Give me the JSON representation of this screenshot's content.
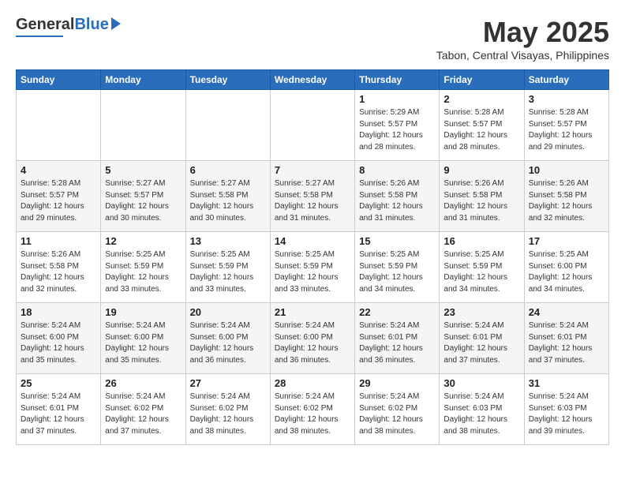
{
  "header": {
    "logo_general": "General",
    "logo_blue": "Blue",
    "month": "May 2025",
    "location": "Tabon, Central Visayas, Philippines"
  },
  "weekdays": [
    "Sunday",
    "Monday",
    "Tuesday",
    "Wednesday",
    "Thursday",
    "Friday",
    "Saturday"
  ],
  "weeks": [
    [
      {
        "day": "",
        "info": ""
      },
      {
        "day": "",
        "info": ""
      },
      {
        "day": "",
        "info": ""
      },
      {
        "day": "",
        "info": ""
      },
      {
        "day": "1",
        "info": "Sunrise: 5:29 AM\nSunset: 5:57 PM\nDaylight: 12 hours\nand 28 minutes."
      },
      {
        "day": "2",
        "info": "Sunrise: 5:28 AM\nSunset: 5:57 PM\nDaylight: 12 hours\nand 28 minutes."
      },
      {
        "day": "3",
        "info": "Sunrise: 5:28 AM\nSunset: 5:57 PM\nDaylight: 12 hours\nand 29 minutes."
      }
    ],
    [
      {
        "day": "4",
        "info": "Sunrise: 5:28 AM\nSunset: 5:57 PM\nDaylight: 12 hours\nand 29 minutes."
      },
      {
        "day": "5",
        "info": "Sunrise: 5:27 AM\nSunset: 5:57 PM\nDaylight: 12 hours\nand 30 minutes."
      },
      {
        "day": "6",
        "info": "Sunrise: 5:27 AM\nSunset: 5:58 PM\nDaylight: 12 hours\nand 30 minutes."
      },
      {
        "day": "7",
        "info": "Sunrise: 5:27 AM\nSunset: 5:58 PM\nDaylight: 12 hours\nand 31 minutes."
      },
      {
        "day": "8",
        "info": "Sunrise: 5:26 AM\nSunset: 5:58 PM\nDaylight: 12 hours\nand 31 minutes."
      },
      {
        "day": "9",
        "info": "Sunrise: 5:26 AM\nSunset: 5:58 PM\nDaylight: 12 hours\nand 31 minutes."
      },
      {
        "day": "10",
        "info": "Sunrise: 5:26 AM\nSunset: 5:58 PM\nDaylight: 12 hours\nand 32 minutes."
      }
    ],
    [
      {
        "day": "11",
        "info": "Sunrise: 5:26 AM\nSunset: 5:58 PM\nDaylight: 12 hours\nand 32 minutes."
      },
      {
        "day": "12",
        "info": "Sunrise: 5:25 AM\nSunset: 5:59 PM\nDaylight: 12 hours\nand 33 minutes."
      },
      {
        "day": "13",
        "info": "Sunrise: 5:25 AM\nSunset: 5:59 PM\nDaylight: 12 hours\nand 33 minutes."
      },
      {
        "day": "14",
        "info": "Sunrise: 5:25 AM\nSunset: 5:59 PM\nDaylight: 12 hours\nand 33 minutes."
      },
      {
        "day": "15",
        "info": "Sunrise: 5:25 AM\nSunset: 5:59 PM\nDaylight: 12 hours\nand 34 minutes."
      },
      {
        "day": "16",
        "info": "Sunrise: 5:25 AM\nSunset: 5:59 PM\nDaylight: 12 hours\nand 34 minutes."
      },
      {
        "day": "17",
        "info": "Sunrise: 5:25 AM\nSunset: 6:00 PM\nDaylight: 12 hours\nand 34 minutes."
      }
    ],
    [
      {
        "day": "18",
        "info": "Sunrise: 5:24 AM\nSunset: 6:00 PM\nDaylight: 12 hours\nand 35 minutes."
      },
      {
        "day": "19",
        "info": "Sunrise: 5:24 AM\nSunset: 6:00 PM\nDaylight: 12 hours\nand 35 minutes."
      },
      {
        "day": "20",
        "info": "Sunrise: 5:24 AM\nSunset: 6:00 PM\nDaylight: 12 hours\nand 36 minutes."
      },
      {
        "day": "21",
        "info": "Sunrise: 5:24 AM\nSunset: 6:00 PM\nDaylight: 12 hours\nand 36 minutes."
      },
      {
        "day": "22",
        "info": "Sunrise: 5:24 AM\nSunset: 6:01 PM\nDaylight: 12 hours\nand 36 minutes."
      },
      {
        "day": "23",
        "info": "Sunrise: 5:24 AM\nSunset: 6:01 PM\nDaylight: 12 hours\nand 37 minutes."
      },
      {
        "day": "24",
        "info": "Sunrise: 5:24 AM\nSunset: 6:01 PM\nDaylight: 12 hours\nand 37 minutes."
      }
    ],
    [
      {
        "day": "25",
        "info": "Sunrise: 5:24 AM\nSunset: 6:01 PM\nDaylight: 12 hours\nand 37 minutes."
      },
      {
        "day": "26",
        "info": "Sunrise: 5:24 AM\nSunset: 6:02 PM\nDaylight: 12 hours\nand 37 minutes."
      },
      {
        "day": "27",
        "info": "Sunrise: 5:24 AM\nSunset: 6:02 PM\nDaylight: 12 hours\nand 38 minutes."
      },
      {
        "day": "28",
        "info": "Sunrise: 5:24 AM\nSunset: 6:02 PM\nDaylight: 12 hours\nand 38 minutes."
      },
      {
        "day": "29",
        "info": "Sunrise: 5:24 AM\nSunset: 6:02 PM\nDaylight: 12 hours\nand 38 minutes."
      },
      {
        "day": "30",
        "info": "Sunrise: 5:24 AM\nSunset: 6:03 PM\nDaylight: 12 hours\nand 38 minutes."
      },
      {
        "day": "31",
        "info": "Sunrise: 5:24 AM\nSunset: 6:03 PM\nDaylight: 12 hours\nand 39 minutes."
      }
    ]
  ]
}
